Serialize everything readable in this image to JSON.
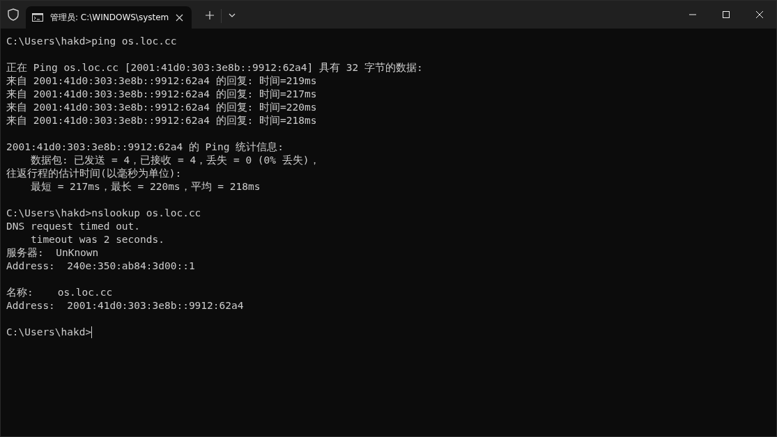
{
  "tab": {
    "title": "管理员: C:\\WINDOWS\\system",
    "selected": true
  },
  "blocks": [
    {
      "lines": [
        "C:\\Users\\hakd>ping os.loc.cc"
      ]
    },
    {
      "lines": [
        "正在 Ping os.loc.cc [2001:41d0:303:3e8b::9912:62a4] 具有 32 字节的数据:",
        "来自 2001:41d0:303:3e8b::9912:62a4 的回复: 时间=219ms",
        "来自 2001:41d0:303:3e8b::9912:62a4 的回复: 时间=217ms",
        "来自 2001:41d0:303:3e8b::9912:62a4 的回复: 时间=220ms",
        "来自 2001:41d0:303:3e8b::9912:62a4 的回复: 时间=218ms"
      ]
    },
    {
      "lines": [
        "2001:41d0:303:3e8b::9912:62a4 的 Ping 统计信息:",
        "    数据包: 已发送 = 4，已接收 = 4，丢失 = 0 (0% 丢失)，",
        "往返行程的估计时间(以毫秒为单位):",
        "    最短 = 217ms，最长 = 220ms，平均 = 218ms"
      ]
    },
    {
      "lines": [
        "C:\\Users\\hakd>nslookup os.loc.cc",
        "DNS request timed out.",
        "    timeout was 2 seconds.",
        "服务器:  UnKnown",
        "Address:  240e:350:ab84:3d00::1"
      ]
    },
    {
      "lines": [
        "名称:    os.loc.cc",
        "Address:  2001:41d0:303:3e8b::9912:62a4"
      ]
    }
  ],
  "prompt": "C:\\Users\\hakd>"
}
